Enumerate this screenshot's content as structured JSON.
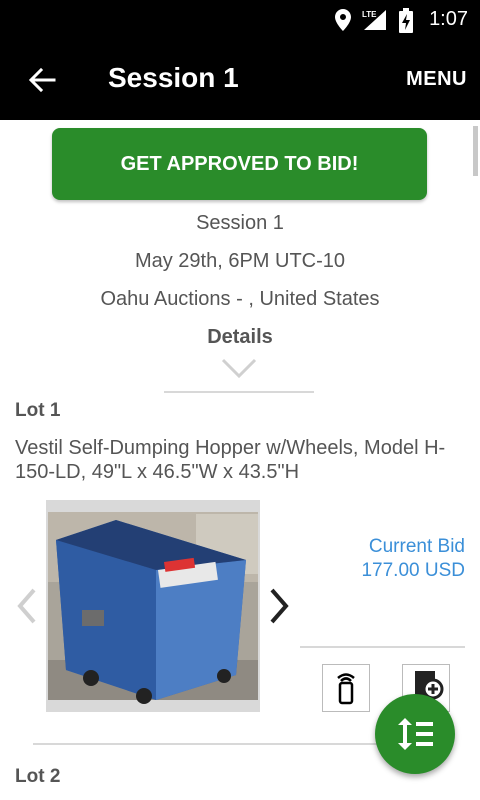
{
  "status_bar": {
    "time": "1:07",
    "network": "LTE"
  },
  "app_bar": {
    "title": "Session 1",
    "menu_label": "MENU"
  },
  "bid_button": {
    "label": "GET APPROVED TO BID!"
  },
  "session": {
    "name": "Session 1",
    "date": "May 29th, 6PM UTC-10",
    "location": "Oahu Auctions - , United States",
    "details_label": "Details"
  },
  "lots": [
    {
      "label": "Lot 1",
      "title": "Vestil Self-Dumping Hopper w/Wheels, Model H-150-LD, 49\"L x 46.5\"W x 43.5\"H",
      "current_bid_label": "Current Bid",
      "current_bid_value": "177.00 USD"
    },
    {
      "label": "Lot 2"
    }
  ],
  "colors": {
    "accent_green": "#2a8c2a",
    "link_blue": "#3b8fd8",
    "text_gray": "#555555"
  }
}
